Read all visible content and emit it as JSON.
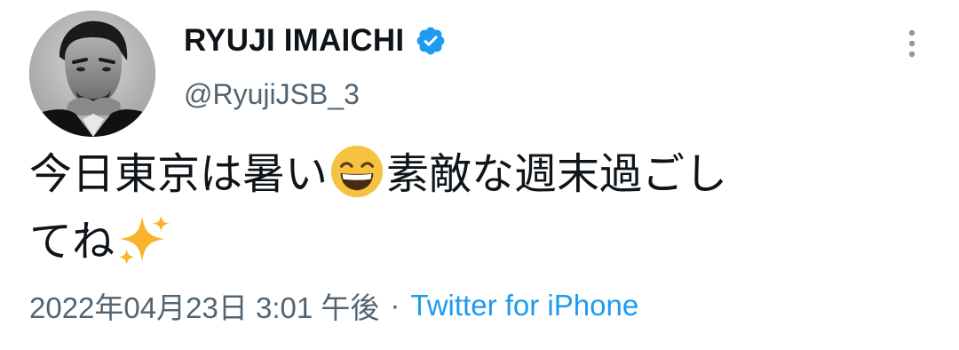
{
  "tweet": {
    "author": {
      "display_name": "RYUJI IMAICHI",
      "handle": "@RyujiJSB_3",
      "verified": true
    },
    "text_part1": "今日東京は暑い",
    "emoji1": "grinning-squinting-face-emoji",
    "text_part2": "素敵な週末過ごし",
    "text_part3": "てね",
    "emoji2": "sparkles-emoji",
    "timestamp": "2022年04月23日 3:01 午後",
    "separator": "·",
    "source": "Twitter for iPhone"
  },
  "colors": {
    "text": "#0f1419",
    "secondary": "#536471",
    "accent": "#1d9bf0"
  },
  "icons": {
    "more": "more-vertical-icon",
    "verified": "verified-badge-icon"
  }
}
